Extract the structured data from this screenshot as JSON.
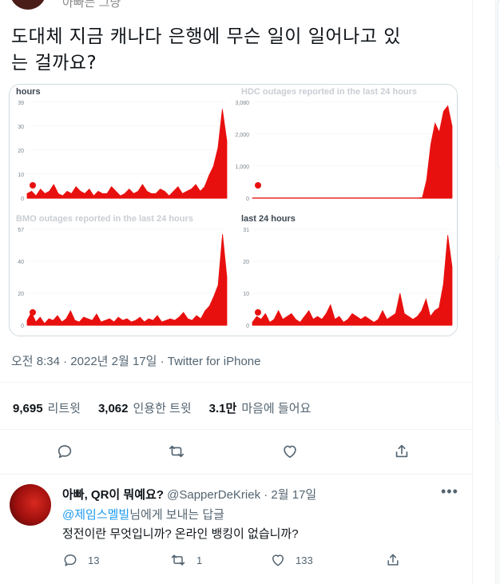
{
  "top_author": {
    "name": "아빠는 그냥"
  },
  "tweet": {
    "text_line1": "도대체 지금 캐나다 은행에 무슨 일이 일어나고 있",
    "text_line2": "는 걸까요?",
    "meta_time": "오전 8:34 · 2022년 2월 17일 · ",
    "meta_source": "Twitter for iPhone"
  },
  "stats": {
    "retweets_count": "9,695",
    "retweets_label": "리트윗",
    "quotes_count": "3,062",
    "quotes_label": "인용한 트윗",
    "likes_count": "3.1만",
    "likes_label": "마음에 들어요"
  },
  "actions": {
    "reply_icon": "reply-icon",
    "retweet_icon": "retweet-icon",
    "like_icon": "heart-icon",
    "share_icon": "share-icon"
  },
  "reply": {
    "name": "아빠, QR이 뭐예요?",
    "handle_date": " @SapperDeKriek · 2월 17일",
    "replying_mention": "@제임스멜빌",
    "replying_suffix": "님에게 보내는 답글",
    "text": "정전이란 무엇입니까? 온라인 뱅킹이 없습니까?",
    "reply_count": "13",
    "retweet_count": "1",
    "like_count": "133"
  },
  "colors": {
    "accent": "#1d9bf0",
    "chart_red": "#e8100f",
    "muted": "#536471"
  },
  "chart_data": [
    {
      "type": "area",
      "title": "hours",
      "yticks": [
        "39",
        "30",
        "20",
        "10",
        "0"
      ],
      "ylim": [
        0,
        42
      ],
      "values": [
        2,
        3,
        1,
        4,
        2,
        3,
        6,
        2,
        1,
        3,
        2,
        5,
        3,
        2,
        4,
        1,
        3,
        2,
        2,
        5,
        3,
        1,
        2,
        4,
        2,
        3,
        6,
        3,
        2,
        2,
        4,
        3,
        1,
        3,
        5,
        2,
        3,
        4,
        6,
        3,
        5,
        10,
        14,
        22,
        39,
        25
      ]
    },
    {
      "type": "area",
      "title": "HDC outages reported in the last 24 hours",
      "yticks": [
        "3,080",
        "2,000",
        "1,000",
        "0"
      ],
      "ylim": [
        0,
        3200
      ],
      "values": [
        5,
        5,
        4,
        6,
        5,
        5,
        4,
        5,
        6,
        5,
        4,
        5,
        5,
        6,
        5,
        4,
        5,
        5,
        6,
        5,
        4,
        5,
        5,
        6,
        5,
        5,
        4,
        5,
        6,
        5,
        5,
        4,
        5,
        6,
        5,
        5,
        4,
        5,
        6,
        5,
        20,
        600,
        1800,
        2500,
        2200,
        2900,
        3080,
        2400
      ]
    },
    {
      "type": "area",
      "title": "BMO outages reported in the last 24 hours",
      "yticks": [
        "57",
        "40",
        "20",
        "0"
      ],
      "ylim": [
        0,
        60
      ],
      "values": [
        3,
        8,
        2,
        5,
        1,
        4,
        3,
        6,
        2,
        4,
        9,
        3,
        2,
        5,
        4,
        3,
        7,
        2,
        3,
        4,
        2,
        5,
        3,
        4,
        2,
        3,
        5,
        2,
        4,
        3,
        6,
        2,
        3,
        4,
        3,
        5,
        8,
        4,
        3,
        6,
        4,
        9,
        12,
        18,
        25,
        57,
        30
      ]
    },
    {
      "type": "area",
      "title": "last 24 hours",
      "yticks": [
        "31",
        "20",
        "10",
        "0"
      ],
      "ylim": [
        0,
        33
      ],
      "values": [
        1,
        3,
        2,
        4,
        1,
        2,
        5,
        2,
        3,
        4,
        2,
        1,
        3,
        5,
        2,
        3,
        2,
        4,
        7,
        2,
        3,
        1,
        2,
        4,
        3,
        2,
        3,
        2,
        1,
        2,
        5,
        2,
        3,
        4,
        11,
        4,
        3,
        2,
        3,
        5,
        9,
        3,
        5,
        6,
        14,
        31,
        20
      ]
    }
  ]
}
